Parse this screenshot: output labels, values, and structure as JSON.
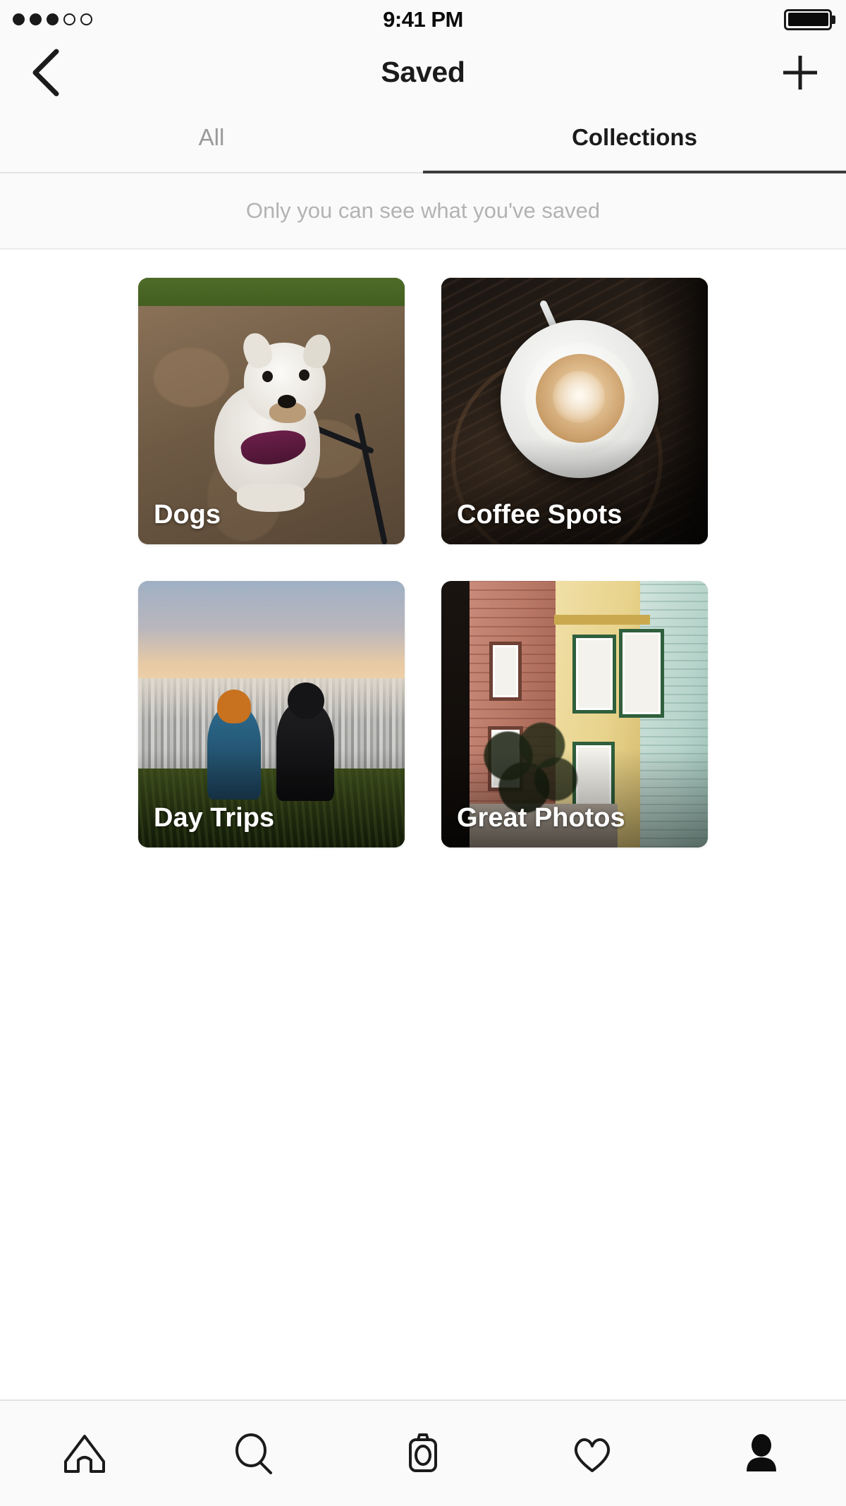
{
  "status_bar": {
    "signal_dots_total": 5,
    "signal_dots_filled": 3,
    "time": "9:41 PM",
    "battery_level_percent": 100,
    "battery_icon": "battery-full-icon"
  },
  "nav_bar": {
    "title": "Saved",
    "back_icon": "chevron-left-icon",
    "add_icon": "plus-icon"
  },
  "tabs": {
    "items": [
      {
        "label": "All",
        "active": false
      },
      {
        "label": "Collections",
        "active": true
      }
    ]
  },
  "info_banner": {
    "text": "Only you can see what you've saved"
  },
  "collections": [
    {
      "name": "Dogs",
      "cover": "dog-on-dirt-path-photo"
    },
    {
      "name": "Coffee Spots",
      "cover": "latte-cup-on-wood-table-photo"
    },
    {
      "name": "Day Trips",
      "cover": "two-people-overlooking-city-photo"
    },
    {
      "name": "Great Photos",
      "cover": "painted-ladies-houses-photo"
    }
  ],
  "bottom_nav": {
    "items": [
      {
        "icon": "home-icon",
        "label": "Home",
        "active": false
      },
      {
        "icon": "search-icon",
        "label": "Search",
        "active": false
      },
      {
        "icon": "camera-icon",
        "label": "Camera",
        "active": false
      },
      {
        "icon": "heart-icon",
        "label": "Activity",
        "active": false
      },
      {
        "icon": "profile-icon",
        "label": "Profile",
        "active": true
      }
    ]
  },
  "colors": {
    "background": "#ffffff",
    "chrome_background": "#fafafa",
    "text_primary": "#1b1b1b",
    "text_inactive": "#9a9a9a",
    "text_muted": "#b3b3b3",
    "divider": "#e4e4e4",
    "tab_indicator": "#3b3b3b",
    "card_label": "#ffffff"
  }
}
